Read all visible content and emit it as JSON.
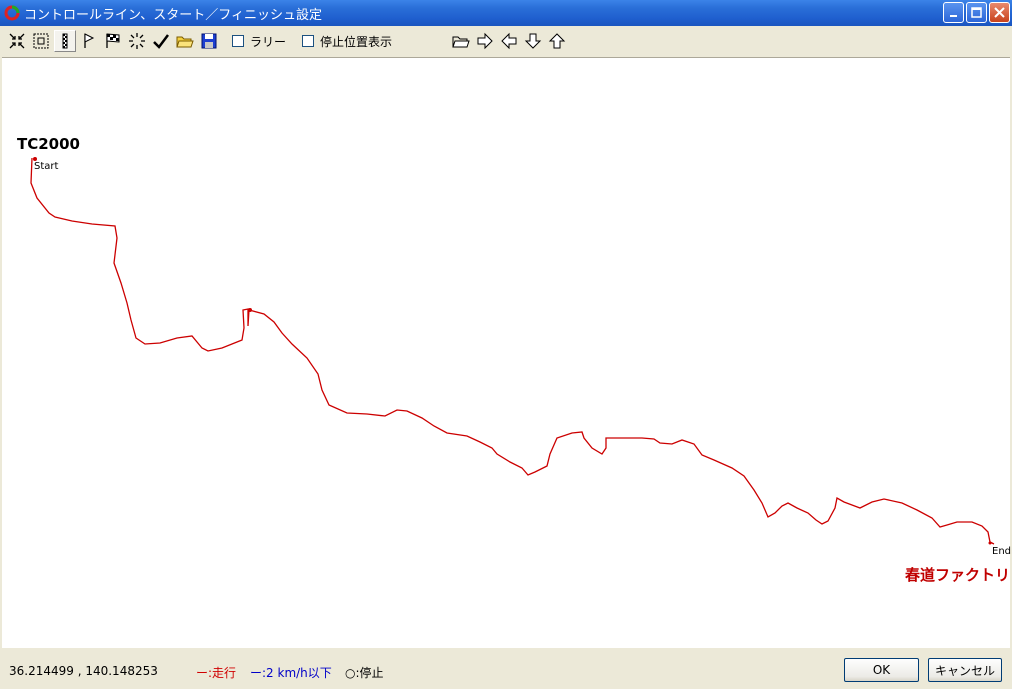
{
  "window": {
    "title": "コントロールライン、スタート／フィニッシュ設定"
  },
  "toolbar": {
    "tools": [
      {
        "name": "shrink-icon",
        "pressed": false
      },
      {
        "name": "fit-icon",
        "pressed": false
      },
      {
        "name": "control-line-icon",
        "pressed": true
      },
      {
        "name": "start-flag-icon",
        "pressed": false
      },
      {
        "name": "finish-flag-icon",
        "pressed": false
      },
      {
        "name": "sparkle-icon",
        "pressed": false
      },
      {
        "name": "checkmark-icon",
        "pressed": false
      },
      {
        "name": "open-folder-icon",
        "pressed": false
      },
      {
        "name": "save-disk-icon",
        "pressed": false
      }
    ],
    "rally_label": "ラリー",
    "stop_display_label": "停止位置表示"
  },
  "map": {
    "start_name": "TC2000",
    "start_label": "Start",
    "end_label": "End",
    "end_name": "春道ファクトリ",
    "track_color": "#cc0000"
  },
  "status": {
    "coordinates": "36.214499 , 140.148253",
    "legend_run": "ー:走行",
    "legend_slow": "ー:2 km/h以下",
    "legend_stop": "○:停止"
  },
  "buttons": {
    "ok": "OK",
    "cancel": "キャンセル"
  },
  "colors": {
    "titlebar": "#2a6fd8",
    "run": "#d00000",
    "slow": "#0000c8"
  }
}
